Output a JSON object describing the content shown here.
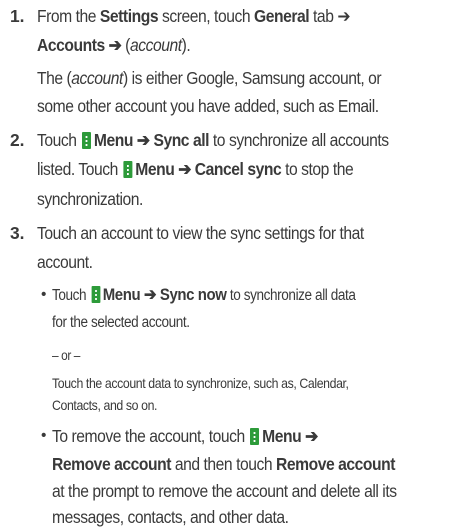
{
  "colors": {
    "text": "#3a3a3a",
    "menu_icon": "#2d9b3a"
  },
  "steps": [
    {
      "number": "1.",
      "l1_a": "From the ",
      "l1_b": "Settings",
      "l1_c": " screen, touch ",
      "l1_d": "General",
      "l1_e": " tab ➔",
      "l2_a": "Accounts ➔ ",
      "l2_b": "(",
      "l2_c": "account",
      "l2_d": ").",
      "note_l1_a": "The (",
      "note_l1_b": "account",
      "note_l1_c": ") is either Google, Samsung account, or",
      "note_l2": "some other account you have added, such as Email."
    },
    {
      "number": "2.",
      "l1_a": "Touch ",
      "l1_b": "Menu ➔ Sync all",
      "l1_c": " to synchronize all accounts",
      "l2_a": "listed. Touch ",
      "l2_b": "Menu ➔ Cancel sync",
      "l2_c": " to stop the",
      "l3": "synchronization."
    },
    {
      "number": "3.",
      "l1": "Touch an account to view the sync settings for that",
      "l2": "account.",
      "bullets": [
        {
          "marker": "•",
          "l1_a": "Touch ",
          "l1_b": "Menu ➔ Sync now",
          "l1_c": " to synchronize all data",
          "l2": "for the selected account.",
          "or": "– or –",
          "alt_l1": "Touch the account data to synchronize, such as, Calendar,",
          "alt_l2": "Contacts, and so on."
        },
        {
          "marker": "•",
          "l1_a": "To remove the account, touch ",
          "l1_b": "Menu ➔",
          "l2_a": "Remove account",
          "l2_b": " and then touch ",
          "l2_c": "Remove account",
          "l3": "at the prompt to remove the account and delete all its",
          "l4": "messages, contacts, and other data."
        }
      ]
    }
  ]
}
